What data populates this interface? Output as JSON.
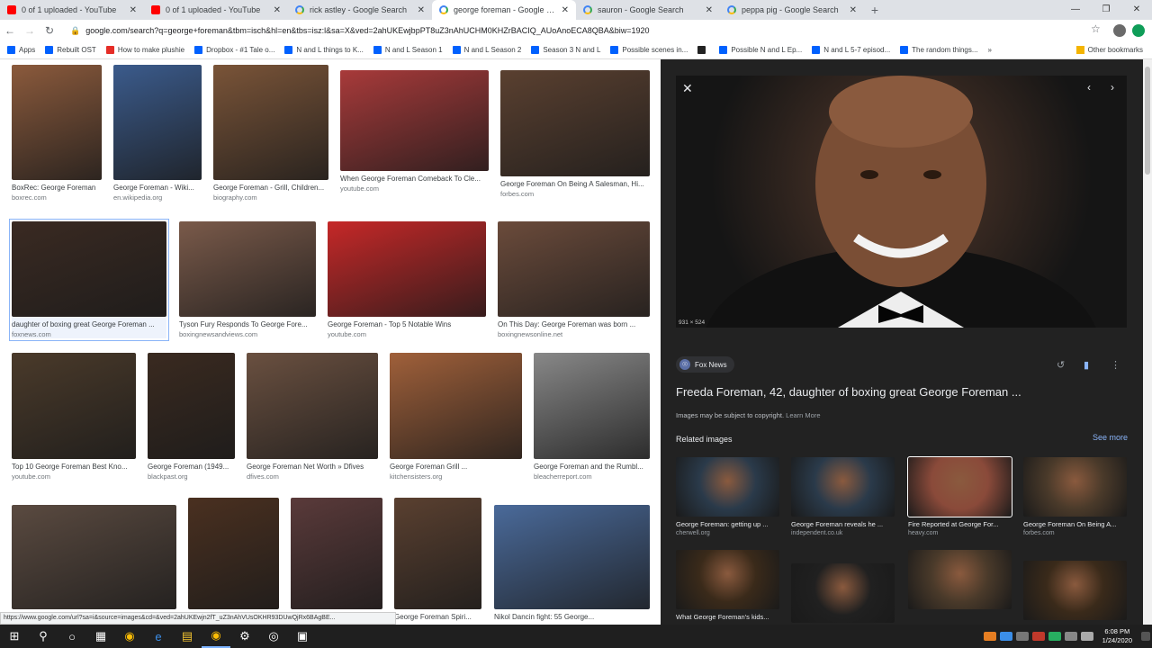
{
  "tabs": [
    {
      "label": "0 of 1 uploaded - YouTube",
      "icon": "youtube-icon",
      "active": false
    },
    {
      "label": "0 of 1 uploaded - YouTube",
      "icon": "youtube-icon",
      "active": false
    },
    {
      "label": "rick astley - Google Search",
      "icon": "google-icon",
      "active": false
    },
    {
      "label": "george foreman - Google Search",
      "icon": "google-icon",
      "active": true
    },
    {
      "label": "sauron - Google Search",
      "icon": "google-icon",
      "active": false
    },
    {
      "label": "peppa pig - Google Search",
      "icon": "google-icon",
      "active": false
    }
  ],
  "address": {
    "url": "google.com/search?q=george+foreman&tbm=isch&hl=en&tbs=isz:l&sa=X&ved=2ahUKEwjbpPT8uZ3nAhUCHM0KHZrBACIQ_AUoAnoECA8QBA&biw=1920"
  },
  "bookmarks": [
    {
      "label": "Apps",
      "icon": "apps-icon",
      "color": "bl"
    },
    {
      "label": "Rebuilt OST",
      "icon": "doc-icon",
      "color": "bl"
    },
    {
      "label": "How to make plushie",
      "icon": "youtube-icon",
      "color": "rd"
    },
    {
      "label": "Dropbox - #1 Tale o...",
      "icon": "dropbox-icon",
      "color": "bl"
    },
    {
      "label": "N and L things to K...",
      "icon": "doc-icon",
      "color": "bl"
    },
    {
      "label": "N and L Season 1",
      "icon": "doc-icon",
      "color": "bl"
    },
    {
      "label": "N and L Season 2",
      "icon": "doc-icon",
      "color": "bl"
    },
    {
      "label": "Season 3 N and L",
      "icon": "doc-icon",
      "color": "bl"
    },
    {
      "label": "Possible scenes in...",
      "icon": "doc-icon",
      "color": "bl"
    },
    {
      "label": "",
      "icon": "medium-icon",
      "color": "bk"
    },
    {
      "label": "Possible N and L Ep...",
      "icon": "doc-icon",
      "color": "bl"
    },
    {
      "label": "N and L 5-7 episod...",
      "icon": "doc-icon",
      "color": "bl"
    },
    {
      "label": "The random things...",
      "icon": "doc-icon",
      "color": "bl"
    }
  ],
  "other_bookmarks": "Other bookmarks",
  "results": [
    {
      "caption": "BoxRec: George Foreman",
      "source": "boxrec.com",
      "color": "#8b5a3c"
    },
    {
      "caption": "George Foreman - Wiki...",
      "source": "en.wikipedia.org",
      "color": "#3b5b8c"
    },
    {
      "caption": "George Foreman - Grill, Children...",
      "source": "biography.com",
      "color": "#7a5438"
    },
    {
      "caption": "When George Foreman Comeback To Cle...",
      "source": "youtube.com",
      "color": "#a83a3a"
    },
    {
      "caption": "George Foreman On Being A Salesman, Hi...",
      "source": "forbes.com",
      "color": "#5a4030"
    },
    {
      "caption": "daughter of boxing great George Foreman ...",
      "source": "foxnews.com",
      "color": "#3a2a22"
    },
    {
      "caption": "Tyson Fury Responds To George Fore...",
      "source": "boxingnewsandviews.com",
      "color": "#7a5a4a"
    },
    {
      "caption": "George Foreman - Top 5 Notable Wins",
      "source": "youtube.com",
      "color": "#c62828"
    },
    {
      "caption": "On This Day: George Foreman was born ...",
      "source": "boxingnewsonline.net",
      "color": "#6b4b3b"
    },
    {
      "caption": "Top 10 George Foreman Best Kno...",
      "source": "youtube.com",
      "color": "#4a3a2a"
    },
    {
      "caption": "George Foreman (1949...",
      "source": "blackpast.org",
      "color": "#3a2a20"
    },
    {
      "caption": "George Foreman Net Worth » Dfives",
      "source": "dfives.com",
      "color": "#6a5040"
    },
    {
      "caption": "George Foreman Grill ...",
      "source": "kitchensisters.org",
      "color": "#a0603a"
    },
    {
      "caption": "George Foreman and the Rumbl...",
      "source": "bleacherreport.com",
      "color": "#888888"
    },
    {
      "caption": "",
      "source": "",
      "color": "#5a4a40"
    },
    {
      "caption": "",
      "source": "",
      "color": "#4a3020"
    },
    {
      "caption": "",
      "source": "",
      "color": "#5a3a3a"
    },
    {
      "caption": "George Foreman Spiri...",
      "source": "",
      "color": "#5a4030"
    },
    {
      "caption": "Nikol Dancin fight: 55 George...",
      "source": "",
      "color": "#4a6a9a"
    }
  ],
  "status_url": "https://www.google.com/url?sa=i&source=images&cd=&ved=2ahUKEwjn2fT_uZ3nAhVUsOKHR93DUwQjRx6BAgBE...",
  "panel": {
    "dimensions": "931 × 524",
    "source": "Fox News",
    "title": "Freeda Foreman, 42, daughter of boxing great George Foreman ...",
    "copyright": "Images may be subject to copyright.",
    "learn_more": "Learn More",
    "related_heading": "Related images",
    "see_more": "See more",
    "related": [
      {
        "caption": "George Foreman: getting up ...",
        "source": "cherwell.org",
        "color": "#2a3a4a"
      },
      {
        "caption": "George Foreman reveals he ...",
        "source": "independent.co.uk",
        "color": "#2a3a4a"
      },
      {
        "caption": "Fire Reported at George For...",
        "source": "heavy.com",
        "color": "#8a4a3a"
      },
      {
        "caption": "George Foreman On Being A...",
        "source": "forbes.com",
        "color": "#4a3a2a"
      },
      {
        "caption": "What George Foreman's kids...",
        "source": "",
        "color": "#3a2a1a"
      },
      {
        "caption": "",
        "source": "",
        "color": "#202020"
      },
      {
        "caption": "",
        "source": "",
        "color": "#4a3a2a"
      },
      {
        "caption": "",
        "source": "",
        "color": "#3a2a1a"
      }
    ]
  },
  "clock": {
    "time": "6:08 PM",
    "date": "1/24/2020"
  }
}
